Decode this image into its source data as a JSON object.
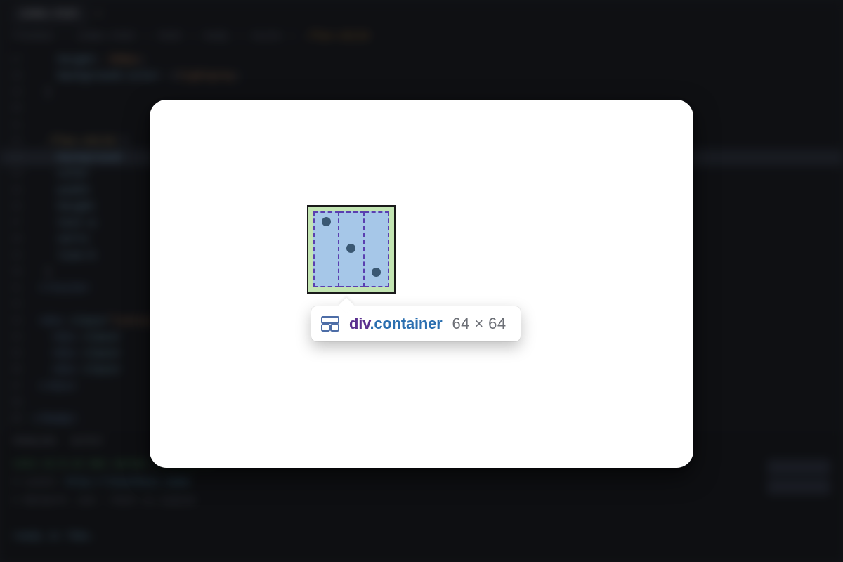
{
  "editor": {
    "tab": "index.html",
    "breadcrumb": [
      "Flexbox",
      "index.html",
      "html",
      "body",
      "style",
      ".flex-child"
    ],
    "lines": {
      "l17a": "height",
      "l17b": "200px",
      "l18a": "background-color",
      "l18b": "lightgray",
      "l22": ".flex-child",
      "l23a": "background",
      "l23b": "",
      "l24a": "color",
      "l24b": "",
      "l25a": "width",
      "l25b": "",
      "l26a": "height",
      "l26b": "",
      "l27a": "text-a",
      "l27b": "",
      "l28a": "verti",
      "l28b": "",
      "l29a": "line-h",
      "l29b": ""
    },
    "panel": {
      "tabs": [
        "PROBLEMS",
        "OUTPUT"
      ],
      "vite": "vite v2.9.12",
      "vite_msg": "dev server running at:",
      "local_label": "Local:",
      "local_url": "http://localhost:3000",
      "net_label": "Network:",
      "net_val": "use --host to expose",
      "ready": "ready in 75ms."
    }
  },
  "tooltip": {
    "element_tag": "div",
    "element_class": ".container",
    "dims": "64 × 64"
  }
}
